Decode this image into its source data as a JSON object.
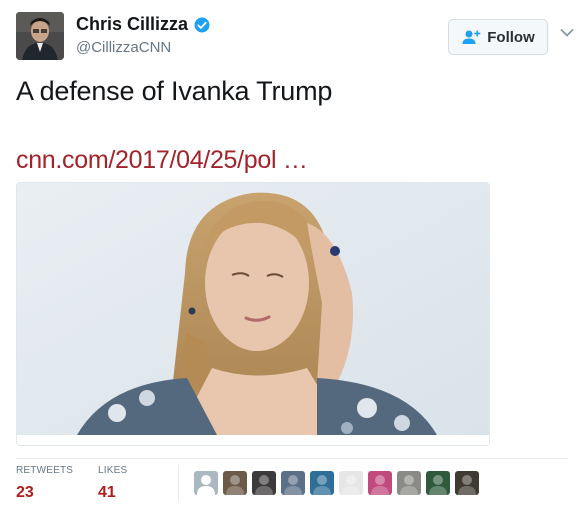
{
  "author": {
    "display_name": "Chris Cillizza",
    "handle": "@CillizzaCNN",
    "verified": true,
    "avatar_icon": "profile-photo"
  },
  "follow_button": {
    "label": "Follow",
    "icon": "add-user-icon"
  },
  "tweet": {
    "text": "A defense of Ivanka Trump",
    "link": "cnn.com/2017/04/25/pol …",
    "link_color": "#a3232b"
  },
  "card": {
    "image": "news-photo"
  },
  "stats": {
    "retweets_label": "RETWEETS",
    "retweets_count": "23",
    "likes_label": "LIKES",
    "likes_count": "41",
    "count_color": "#b01c1c"
  },
  "liker_avatars": [
    {
      "icon": "default-egg-avatar",
      "color": "#aab8c2"
    },
    {
      "icon": "user-avatar",
      "color": "#6b5a48"
    },
    {
      "icon": "user-avatar",
      "color": "#3c3a3a"
    },
    {
      "icon": "user-avatar",
      "color": "#5b6f86"
    },
    {
      "icon": "user-avatar",
      "color": "#2f6e97"
    },
    {
      "icon": "user-avatar",
      "color": "#e6e6e6"
    },
    {
      "icon": "user-avatar",
      "color": "#c04a7d"
    },
    {
      "icon": "user-avatar",
      "color": "#8a8a86"
    },
    {
      "icon": "user-avatar",
      "color": "#2f5b3c"
    },
    {
      "icon": "user-avatar",
      "color": "#3f3a32"
    }
  ]
}
